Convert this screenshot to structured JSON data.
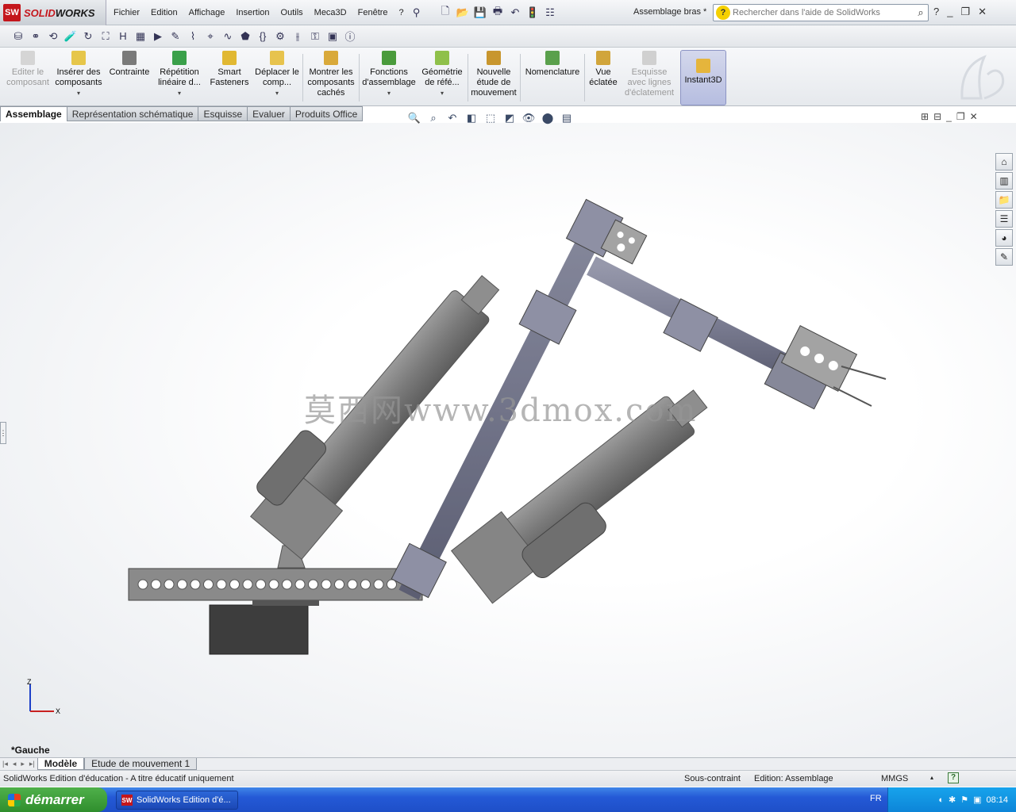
{
  "app": {
    "brand_prefix": "SW",
    "brand_name_a": "SOLID",
    "brand_name_b": "WORKS"
  },
  "menu": [
    "Fichier",
    "Edition",
    "Affichage",
    "Insertion",
    "Outils",
    "Meca3D",
    "Fenêtre",
    "?"
  ],
  "document_title": "Assemblage bras *",
  "search": {
    "placeholder": "Rechercher dans l'aide de SolidWorks"
  },
  "commands": [
    {
      "label": "Editer le composant",
      "enabled": false
    },
    {
      "label": "Insérer des composants",
      "enabled": true
    },
    {
      "label": "Contrainte",
      "enabled": true
    },
    {
      "label": "Répétition linéaire d...",
      "enabled": true
    },
    {
      "label": "Smart Fasteners",
      "enabled": true
    },
    {
      "label": "Déplacer le comp...",
      "enabled": true
    },
    {
      "label": "Montrer les composants cachés",
      "enabled": true
    },
    {
      "label": "Fonctions d'assemblage",
      "enabled": true
    },
    {
      "label": "Géométrie de réfé...",
      "enabled": true
    },
    {
      "label": "Nouvelle étude de mouvement",
      "enabled": true
    },
    {
      "label": "Nomenclature",
      "enabled": true
    },
    {
      "label": "Vue éclatée",
      "enabled": true
    },
    {
      "label": "Esquisse avec lignes d'éclatement",
      "enabled": false
    },
    {
      "label": "Instant3D",
      "enabled": true,
      "active": true
    }
  ],
  "tabs": [
    "Assemblage",
    "Représentation schématique",
    "Esquisse",
    "Evaluer",
    "Produits Office"
  ],
  "active_tab": "Assemblage",
  "watermark": "莫西网www.3dmox.com",
  "view": {
    "label": "*Gauche",
    "axis_z": "Z",
    "axis_x": "X"
  },
  "bottom_tabs": [
    "Modèle",
    "Etude de mouvement 1"
  ],
  "status": {
    "left": "SolidWorks Edition d'éducation - A titre éducatif uniquement",
    "constraint": "Sous-contraint",
    "edition": "Edition: Assemblage",
    "units": "MMGS"
  },
  "taskbar": {
    "start": "démarrer",
    "task": "SolidWorks Edition d'é...",
    "lang": "FR",
    "clock": "08:14"
  },
  "colors": {
    "brand_red": "#c4161c",
    "part_gray": "#7f7f7f",
    "arm_blue_gray": "#7d7f94",
    "xp_blue": "#2459d6",
    "xp_green": "#3ca03a"
  }
}
